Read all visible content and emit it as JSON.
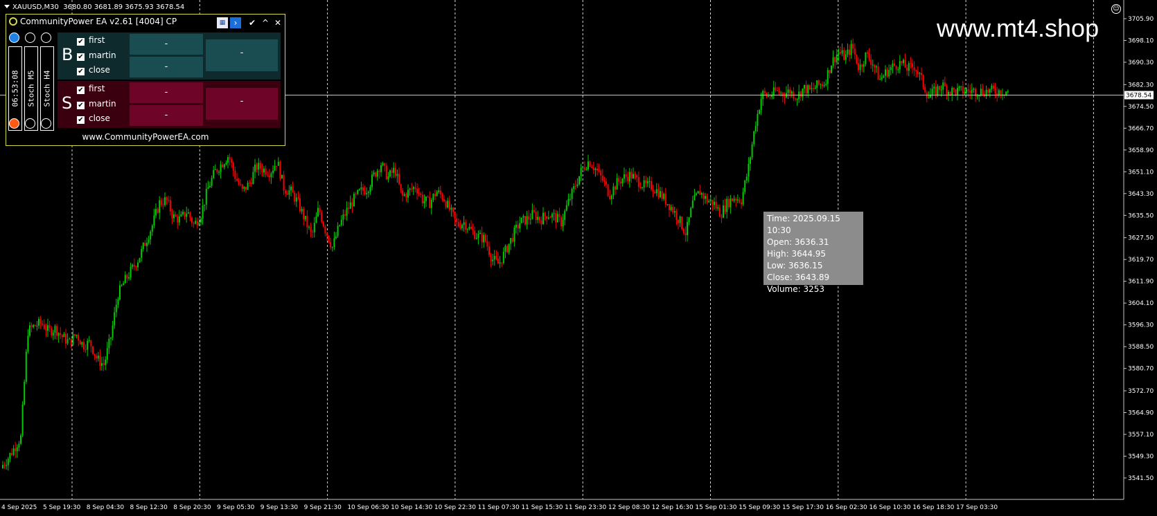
{
  "symbol_header": {
    "symbol": "XAUUSD,M30",
    "ohlc": "3680.80 3681.89 3675.93 3678.54"
  },
  "brand": "www.mt4.shop",
  "ea_panel": {
    "title": "CommunityPower EA v2.61 [4004] CP",
    "vertical_labels": [
      "06:53:08",
      "Stoch M5",
      "Stoch H4"
    ],
    "buy": {
      "letter": "B",
      "rows": [
        "first",
        "martin",
        "close"
      ],
      "cells": [
        "-",
        "-",
        "-"
      ]
    },
    "sell": {
      "letter": "S",
      "rows": [
        "first",
        "martin",
        "close"
      ],
      "cells": [
        "-",
        "-",
        "-"
      ]
    },
    "footer": "www.CommunityPowerEA.com",
    "top_circle_colors": [
      "#1e82e6",
      "#000000",
      "#000000"
    ],
    "bottom_circle_colors": [
      "#ff5a14",
      "#000000",
      "#000000"
    ]
  },
  "tooltip": {
    "time": "Time: 2025.09.15 10:30",
    "open": "Open: 3636.31",
    "high": "High: 3644.95",
    "low": "Low:  3636.15",
    "close": "Close: 3643.89",
    "volume": "Volume: 3253"
  },
  "chart_data": {
    "type": "candlestick",
    "price_labels": [
      "3705.90",
      "3698.10",
      "3690.30",
      "3682.30",
      "3674.50",
      "3666.70",
      "3658.90",
      "3651.10",
      "3643.30",
      "3635.50",
      "3627.50",
      "3619.70",
      "3611.90",
      "3604.10",
      "3596.30",
      "3588.50",
      "3580.70",
      "3572.70",
      "3564.90",
      "3557.10",
      "3549.30",
      "3541.50"
    ],
    "current_price": "3678.54",
    "time_labels": [
      "4 Sep 2025",
      "5 Sep 19:30",
      "8 Sep 04:30",
      "8 Sep 12:30",
      "8 Sep 20:30",
      "9 Sep 05:30",
      "9 Sep 13:30",
      "9 Sep 21:30",
      "10 Sep 06:30",
      "10 Sep 14:30",
      "10 Sep 22:30",
      "11 Sep 07:30",
      "11 Sep 15:30",
      "11 Sep 23:30",
      "12 Sep 08:30",
      "12 Sep 16:30",
      "15 Sep 01:30",
      "15 Sep 09:30",
      "15 Sep 17:30",
      "16 Sep 02:30",
      "16 Sep 10:30",
      "16 Sep 18:30",
      "17 Sep 03:30"
    ],
    "price_path": [
      [
        0,
        3545
      ],
      [
        10,
        3548
      ],
      [
        20,
        3552
      ],
      [
        30,
        3556
      ],
      [
        40,
        3594
      ],
      [
        50,
        3596
      ],
      [
        60,
        3597
      ],
      [
        70,
        3594
      ],
      [
        80,
        3595
      ],
      [
        90,
        3592
      ],
      [
        100,
        3590
      ],
      [
        110,
        3593
      ],
      [
        120,
        3589
      ],
      [
        130,
        3590
      ],
      [
        140,
        3584
      ],
      [
        150,
        3582
      ],
      [
        160,
        3592
      ],
      [
        170,
        3607
      ],
      [
        180,
        3612
      ],
      [
        190,
        3616
      ],
      [
        200,
        3620
      ],
      [
        210,
        3626
      ],
      [
        220,
        3632
      ],
      [
        230,
        3640
      ],
      [
        240,
        3641
      ],
      [
        250,
        3635
      ],
      [
        260,
        3634
      ],
      [
        270,
        3637
      ],
      [
        280,
        3632
      ],
      [
        290,
        3636
      ],
      [
        300,
        3645
      ],
      [
        310,
        3651
      ],
      [
        320,
        3654
      ],
      [
        330,
        3657
      ],
      [
        340,
        3649
      ],
      [
        350,
        3644
      ],
      [
        360,
        3647
      ],
      [
        370,
        3653
      ],
      [
        380,
        3652
      ],
      [
        390,
        3651
      ],
      [
        400,
        3655
      ],
      [
        410,
        3645
      ],
      [
        420,
        3644
      ],
      [
        430,
        3640
      ],
      [
        440,
        3634
      ],
      [
        450,
        3628
      ],
      [
        460,
        3638
      ],
      [
        470,
        3630
      ],
      [
        480,
        3624
      ],
      [
        490,
        3632
      ],
      [
        500,
        3637
      ],
      [
        510,
        3641
      ],
      [
        520,
        3644
      ],
      [
        530,
        3645
      ],
      [
        540,
        3650
      ],
      [
        550,
        3654
      ],
      [
        560,
        3649
      ],
      [
        570,
        3652
      ],
      [
        580,
        3642
      ],
      [
        590,
        3644
      ],
      [
        600,
        3646
      ],
      [
        610,
        3641
      ],
      [
        620,
        3640
      ],
      [
        630,
        3644
      ],
      [
        640,
        3642
      ],
      [
        650,
        3637
      ],
      [
        660,
        3632
      ],
      [
        670,
        3633
      ],
      [
        680,
        3630
      ],
      [
        690,
        3628
      ],
      [
        700,
        3627
      ],
      [
        710,
        3620
      ],
      [
        720,
        3618
      ],
      [
        730,
        3623
      ],
      [
        740,
        3628
      ],
      [
        750,
        3633
      ],
      [
        760,
        3634
      ],
      [
        770,
        3636
      ],
      [
        780,
        3634
      ],
      [
        790,
        3636
      ],
      [
        800,
        3635
      ],
      [
        810,
        3633
      ],
      [
        820,
        3640
      ],
      [
        830,
        3646
      ],
      [
        840,
        3652
      ],
      [
        850,
        3655
      ],
      [
        860,
        3652
      ],
      [
        870,
        3648
      ],
      [
        880,
        3643
      ],
      [
        890,
        3647
      ],
      [
        900,
        3649
      ],
      [
        910,
        3650
      ],
      [
        920,
        3648
      ],
      [
        930,
        3646
      ],
      [
        940,
        3646
      ],
      [
        950,
        3644
      ],
      [
        960,
        3641
      ],
      [
        970,
        3638
      ],
      [
        980,
        3634
      ],
      [
        990,
        3629
      ],
      [
        1000,
        3640
      ],
      [
        1010,
        3644
      ],
      [
        1020,
        3641
      ],
      [
        1030,
        3640
      ],
      [
        1040,
        3636
      ],
      [
        1050,
        3640
      ],
      [
        1060,
        3642
      ],
      [
        1070,
        3641
      ],
      [
        1080,
        3652
      ],
      [
        1090,
        3668
      ],
      [
        1100,
        3679
      ],
      [
        1110,
        3678
      ],
      [
        1120,
        3680
      ],
      [
        1130,
        3679
      ],
      [
        1140,
        3680
      ],
      [
        1150,
        3678
      ],
      [
        1160,
        3681
      ],
      [
        1170,
        3680
      ],
      [
        1180,
        3682
      ],
      [
        1190,
        3683
      ],
      [
        1200,
        3690
      ],
      [
        1210,
        3694
      ],
      [
        1220,
        3692
      ],
      [
        1230,
        3696
      ],
      [
        1240,
        3688
      ],
      [
        1250,
        3693
      ],
      [
        1260,
        3690
      ],
      [
        1270,
        3684
      ],
      [
        1280,
        3687
      ],
      [
        1290,
        3689
      ],
      [
        1300,
        3690
      ],
      [
        1310,
        3688
      ],
      [
        1320,
        3689
      ],
      [
        1330,
        3684
      ],
      [
        1340,
        3678
      ],
      [
        1350,
        3680
      ],
      [
        1360,
        3682
      ],
      [
        1370,
        3680
      ]
    ],
    "grid": "vertical-dashed",
    "bull_color": "#00cc00",
    "bear_color": "#ff0000"
  }
}
